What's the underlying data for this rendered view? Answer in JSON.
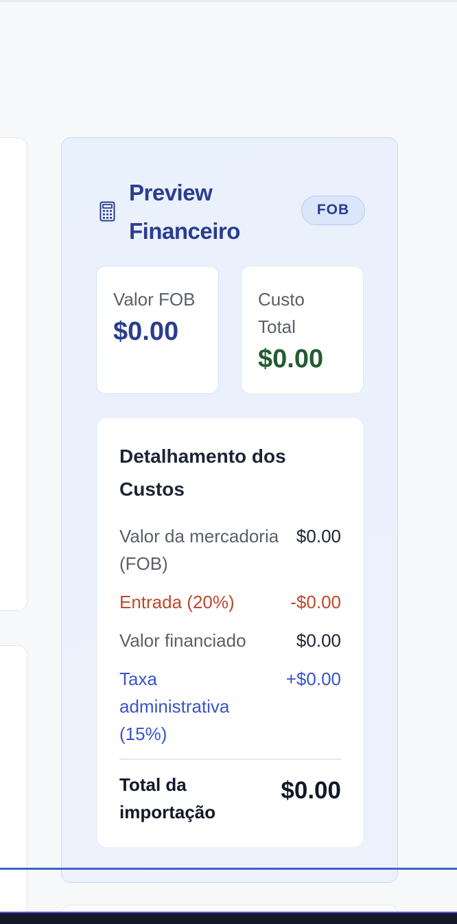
{
  "panel": {
    "title": "Preview Financeiro",
    "icon": "calculator-icon",
    "badge": "FOB"
  },
  "stats": {
    "fob": {
      "label": "Valor FOB",
      "value": "$0.00"
    },
    "total": {
      "label": "Custo Total",
      "value": "$0.00"
    }
  },
  "breakdown": {
    "title": "Detalhamento dos Custos",
    "rows": [
      {
        "label": "Valor da mercadoria (FOB)",
        "value": "$0.00"
      },
      {
        "label": "Entrada (20%)",
        "value": "-$0.00"
      },
      {
        "label": "Valor financiado",
        "value": "$0.00"
      },
      {
        "label": "Taxa administrativa (15%)",
        "value": "+$0.00"
      }
    ],
    "total": {
      "label": "Total da importação",
      "value": "$0.00"
    }
  },
  "colors": {
    "accent": "#2a3d8f",
    "success": "#245b33",
    "negative": "#c1462a",
    "fee": "#3755c8"
  }
}
